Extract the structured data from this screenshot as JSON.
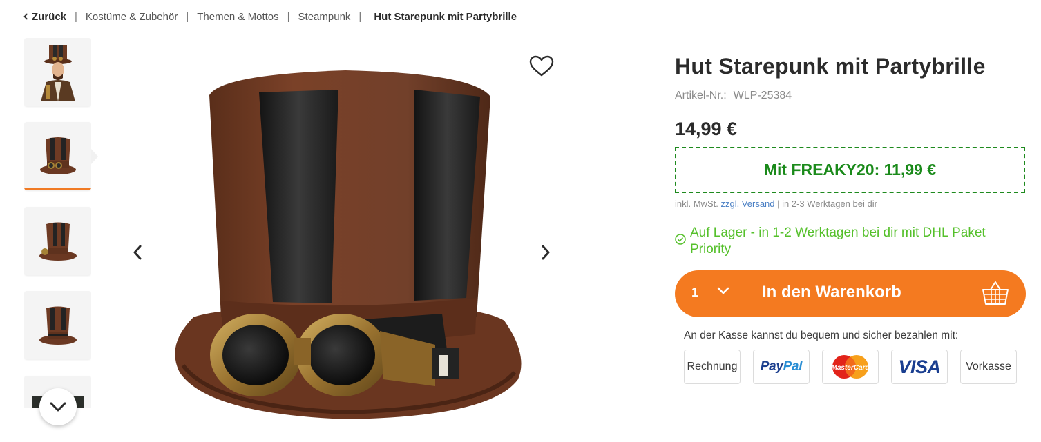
{
  "breadcrumb": {
    "back": "Zurück",
    "items": [
      "Kostüme & Zubehör",
      "Themen & Mottos",
      "Steampunk"
    ],
    "current": "Hut Starepunk mit Partybrille"
  },
  "product": {
    "title": "Hut Starepunk mit Partybrille",
    "sku_label": "Artikel-Nr.:",
    "sku": "WLP-25384",
    "price": "14,99 €",
    "coupon": "Mit FREAKY20: 11,99 €",
    "tax_prefix": "inkl. MwSt.",
    "shipping_link": "zzgl. Versand",
    "tax_suffix": "| in 2-3 Werktagen bei dir",
    "stock": "Auf Lager - in 1-2 Werktagen bei dir mit DHL Paket Priority"
  },
  "cart": {
    "quantity": "1",
    "button_label": "In den Warenkorb"
  },
  "payment": {
    "note": "An der Kasse kannst du bequem und sicher bezahlen mit:",
    "invoice": "Rechnung",
    "paypal_a": "Pay",
    "paypal_b": "Pal",
    "mastercard": "MasterCard",
    "visa": "VISA",
    "prepayment": "Vorkasse"
  },
  "colors": {
    "accent": "#f47a20",
    "coupon_green": "#1a8a1a",
    "stock_green": "#55c02b",
    "link_blue": "#4a7fc4"
  },
  "icons": [
    "chevron-left-icon",
    "heart-icon",
    "chevron-right-icon",
    "chevron-down-icon",
    "check-circle-icon",
    "basket-icon"
  ]
}
